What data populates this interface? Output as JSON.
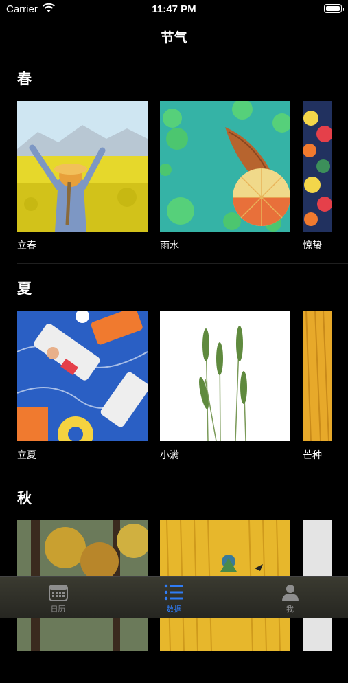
{
  "status": {
    "carrier": "Carrier",
    "time": "11:47 PM"
  },
  "nav": {
    "title": "节气"
  },
  "sections": [
    {
      "title": "春",
      "items": [
        {
          "label": "立春"
        },
        {
          "label": "雨水"
        },
        {
          "label": "惊蛰"
        }
      ]
    },
    {
      "title": "夏",
      "items": [
        {
          "label": "立夏"
        },
        {
          "label": "小满"
        },
        {
          "label": "芒种"
        }
      ]
    },
    {
      "title": "秋",
      "items": [
        {
          "label": ""
        },
        {
          "label": ""
        },
        {
          "label": ""
        }
      ]
    }
  ],
  "tabbar": {
    "tabs": [
      {
        "label": "日历",
        "icon": "calendar-icon"
      },
      {
        "label": "数据",
        "icon": "list-icon"
      },
      {
        "label": "我",
        "icon": "person-icon"
      }
    ],
    "active_color": "#2f7cf6",
    "inactive_color": "#8e8e8e"
  }
}
